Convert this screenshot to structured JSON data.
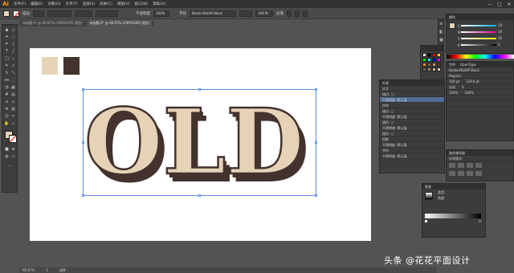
{
  "app": {
    "logo": "Ai"
  },
  "menu": [
    "文件(F)",
    "编辑(E)",
    "对象(O)",
    "文字(T)",
    "选择(S)",
    "效果(C)",
    "视图(V)",
    "窗口(W)",
    "帮助(H)"
  ],
  "window_controls": [
    "—",
    "□",
    "✕"
  ],
  "control_bar": {
    "fill_label": "描边",
    "opacity_label": "不透明度",
    "opacity_value": "100%",
    "char_label": "字符",
    "font_name": "BodoniStdHP Black",
    "size_value": "108 Pt",
    "para_label": "段落"
  },
  "tabs": [
    {
      "label": "未标题-1* @ 66.67% (CMYK/GPU 预览)",
      "active": false
    },
    {
      "label": "未标题-2* @ 66.67% (CMYK/GPU 预览)",
      "active": true
    }
  ],
  "artwork": {
    "text": "OLD",
    "face": "#e6d3b7",
    "shadow": "#43322e"
  },
  "artboard_swatches": [
    "#e6d3b7",
    "#43322e"
  ],
  "status": {
    "zoom": "66.67%",
    "page": "1",
    "mode": "选择"
  },
  "color_panel": {
    "title": "颜色",
    "rows": [
      "C",
      "M",
      "Y",
      "K"
    ],
    "values": [
      "10",
      "18",
      "30",
      "0"
    ]
  },
  "swatch_colors": [
    "#ffffff",
    "#000000",
    "#ff0000",
    "#ffff00",
    "#00ff00",
    "#00ffff",
    "#0000ff",
    "#ff00ff",
    "#f7931e",
    "#8c6239",
    "#c69c6d",
    "#603813",
    "#736357",
    "#998675",
    "#c7b299",
    "#e6d3b7"
  ],
  "char_panel": {
    "title": "字符",
    "tab2": "OpenType",
    "font": "BodoniStdHP Black",
    "style": "Regular",
    "size": "108 pt",
    "leading": "129.6 pt",
    "tracking": "自动",
    "kerning": "0",
    "scale_h": "100%",
    "scale_v": "100%"
  },
  "appearance_panel": {
    "title": "外观",
    "rows": [
      "文字",
      "描边: ▢",
      "不透明度: 默认值",
      "字符",
      "描边: ▢",
      "不透明度: 默认值",
      "填色: ▢",
      "不透明度: 默认值",
      "描边: ▢",
      "投影",
      "不透明度: 默认值",
      "字符",
      "不透明度: 默认值"
    ],
    "selected_row": 2
  },
  "align_panel": {
    "title": "路径查找器",
    "label": "形状模式:"
  },
  "gradient_panel": {
    "title": "渐变",
    "type": "类型:",
    "angle": "角度:"
  },
  "watermark": "头条 @花花平面设计"
}
